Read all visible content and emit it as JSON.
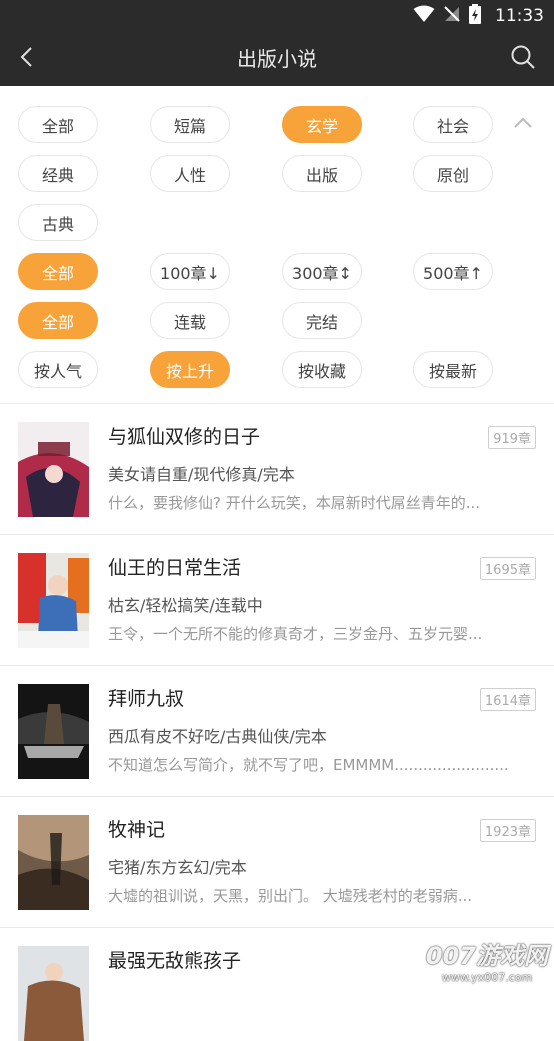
{
  "status_bar": {
    "time": "11:33"
  },
  "app_bar": {
    "title": "出版小说"
  },
  "filters": {
    "rows": [
      [
        {
          "label": "全部",
          "active": false
        },
        {
          "label": "短篇",
          "active": false
        },
        {
          "label": "玄学",
          "active": true
        },
        {
          "label": "社会",
          "active": false
        }
      ],
      [
        {
          "label": "经典",
          "active": false
        },
        {
          "label": "人性",
          "active": false
        },
        {
          "label": "出版",
          "active": false
        },
        {
          "label": "原创",
          "active": false
        }
      ],
      [
        {
          "label": "古典",
          "active": false
        }
      ],
      [
        {
          "label": "全部",
          "active": true
        },
        {
          "label": "100章↓",
          "active": false
        },
        {
          "label": "300章↕",
          "active": false
        },
        {
          "label": "500章↑",
          "active": false
        }
      ],
      [
        {
          "label": "全部",
          "active": true
        },
        {
          "label": "连载",
          "active": false
        },
        {
          "label": "完结",
          "active": false
        }
      ],
      [
        {
          "label": "按人气",
          "active": false
        },
        {
          "label": "按上升",
          "active": true
        },
        {
          "label": "按收藏",
          "active": false
        },
        {
          "label": "按最新",
          "active": false
        }
      ]
    ]
  },
  "books": [
    {
      "title": "与狐仙双修的日子",
      "chapters": "919章",
      "meta": "美女请自重/现代修真/完本",
      "desc": "什么，要我修仙? 开什么玩笑，本屌新时代屌丝青年的..."
    },
    {
      "title": "仙王的日常生活",
      "chapters": "1695章",
      "meta": "枯玄/轻松搞笑/连载中",
      "desc": "王令，一个无所不能的修真奇才，三岁金丹、五岁元婴..."
    },
    {
      "title": "拜师九叔",
      "chapters": "1614章",
      "meta": "西瓜有皮不好吃/古典仙侠/完本",
      "desc": "不知道怎么写简介，就不写了吧，EMMMM........................"
    },
    {
      "title": "牧神记",
      "chapters": "1923章",
      "meta": "宅猪/东方玄幻/完本",
      "desc": "大墟的祖训说，天黑，别出门。 大墟残老村的老弱病..."
    },
    {
      "title": "最强无敌熊孩子",
      "chapters": "",
      "meta": "",
      "desc": ""
    }
  ],
  "watermark": {
    "main": "007游戏网",
    "sub": "www.yx007.com"
  },
  "colors": {
    "accent": "#f7a33a",
    "bar": "#2b2b2b"
  }
}
